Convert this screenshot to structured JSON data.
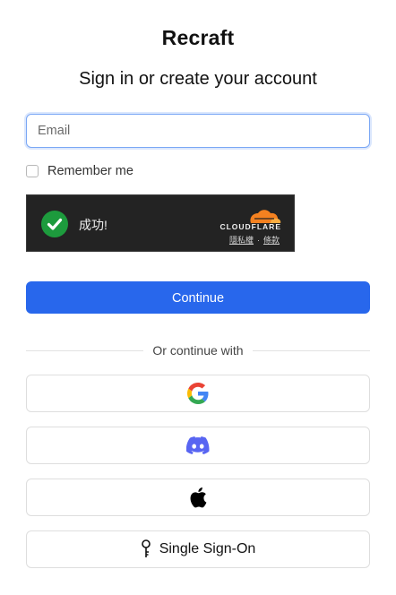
{
  "header": {
    "app_title": "Recraft",
    "subtitle": "Sign in or create your account"
  },
  "form": {
    "email_placeholder": "Email",
    "email_value": "",
    "remember_label": "Remember me",
    "remember_checked": false,
    "continue_label": "Continue"
  },
  "captcha": {
    "status_text": "成功!",
    "brand": "CLOUDFLARE",
    "privacy_link": "隱私權",
    "separator": "·",
    "terms_link": "條款",
    "colors": {
      "background": "#232323",
      "success": "#1d9b3d",
      "brand_orange": "#f48120"
    }
  },
  "social": {
    "divider_text": "Or continue with",
    "providers": [
      {
        "name": "Google",
        "icon": "google-icon"
      },
      {
        "name": "Discord",
        "icon": "discord-icon"
      },
      {
        "name": "Apple",
        "icon": "apple-icon"
      }
    ],
    "sso_label": "Single Sign-On",
    "sso_icon": "key-icon"
  },
  "colors": {
    "accent": "#2867ec",
    "discord": "#5865f2"
  }
}
